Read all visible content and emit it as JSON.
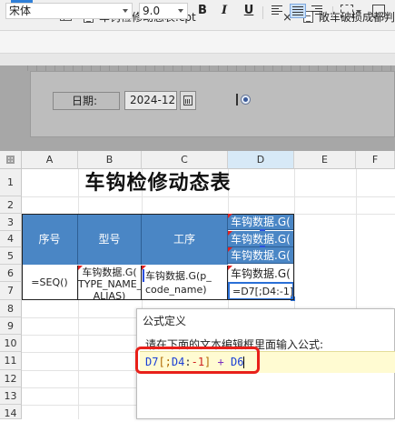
{
  "tabs": [
    {
      "label": "车钩检修动态表.cpt",
      "close": "×"
    },
    {
      "label": "敞车破损成都判"
    }
  ],
  "toolbar": {
    "font_name": "宋体",
    "font_size": "9.0",
    "bold": "B",
    "italic": "I",
    "underline": "U"
  },
  "params": {
    "date_label": "日期:",
    "date_value": "2024-12"
  },
  "columns": [
    "A",
    "B",
    "C",
    "D",
    "E",
    "F"
  ],
  "rows": [
    "1",
    "2",
    "3",
    "4",
    "5",
    "6",
    "7",
    "8",
    "9",
    "10",
    "11",
    "12",
    "13",
    "14"
  ],
  "report": {
    "title": "车钩检修动态表",
    "headers": [
      "序号",
      "型号",
      "工序"
    ],
    "d_cells": [
      "车钩数据.G(",
      "车钩数据.G(",
      "车钩数据.G(",
      "车钩数据.G("
    ],
    "row6": {
      "a": "=SEQ()",
      "b": "车钩数据.G(",
      "b2": "TYPE_NAME_",
      "b3": "ALIAS)",
      "c": "车钩数据.G(p_",
      "c2": "code_name)",
      "d": "车钩数据.G("
    },
    "d7": "=D7[;D4:-1]"
  },
  "dialog": {
    "title": "公式定义",
    "prompt": "请在下面的文本编辑框里面输入公式:",
    "formula_parts": [
      "D7",
      "[;",
      "D4",
      ":",
      "-1",
      "]",
      " + ",
      "D6"
    ]
  },
  "colors": {
    "header_blue": "#4a86c5",
    "highlight_red": "#e8201a",
    "editor_bg": "#fffbd2",
    "formula_cellref": "#1a3fd6",
    "formula_bracket": "#b06a00",
    "formula_number": "#d02020",
    "formula_operator": "#7b2fbf"
  }
}
